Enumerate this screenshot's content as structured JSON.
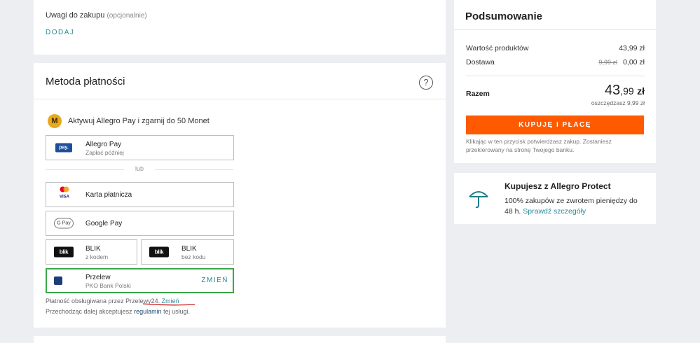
{
  "notes": {
    "label": "Uwagi do zakupu",
    "optional": "(opcjonalnie)",
    "add": "DODAJ"
  },
  "payment": {
    "title": "Metoda płatności",
    "help": "?",
    "promo": {
      "coin": "M",
      "text": "Aktywuj Allegro Pay i zgarnij do 50 Monet"
    },
    "allegro_pay": {
      "badge": "pay.",
      "name": "Allegro Pay",
      "sub": "Zapłać później"
    },
    "or": "lub",
    "card": {
      "name": "Karta płatnicza",
      "visa": "VISA"
    },
    "gpay": {
      "badge": "G Pay",
      "name": "Google Pay"
    },
    "blik1": {
      "badge": "blik",
      "name": "BLIK",
      "sub": "z kodem"
    },
    "blik2": {
      "badge": "blik",
      "name": "BLIK",
      "sub": "bez kodu"
    },
    "transfer": {
      "name": "Przelew",
      "sub": "PKO Bank Polski",
      "change": "ZMIEŃ"
    },
    "handled_by": "Płatność obsługiwana przez Przelewy24.",
    "handled_change": "Zmień",
    "accept_prefix": "Przechodząc dalej akceptujesz",
    "accept_link": "regulamin",
    "accept_suffix": "tej usługi."
  },
  "summary": {
    "title": "Podsumowanie",
    "products_label": "Wartość produktów",
    "products_value": "43,99 zł",
    "delivery_label": "Dostawa",
    "delivery_old": "9,99 zł",
    "delivery_value": "0,00 zł",
    "total_label": "Razem",
    "total_int": "43",
    "total_dec": ",99",
    "total_cur": "zł",
    "savings": "oszczędzasz 9,99 zł",
    "buy": "KUPUJĘ I PŁACĘ",
    "buy_note": "Klikając w ten przycisk potwierdzasz zakup. Zostaniesz przekierowany na stronę Twojego banku."
  },
  "protect": {
    "title": "Kupujesz z Allegro Protect",
    "text": "100% zakupów ze zwrotem pieniędzy do 48 h.",
    "link": "Sprawdź szczegóły"
  },
  "colors": {
    "accent": "#ff5a00",
    "link": "#2a8a9a",
    "selected_border": "#3aa84a"
  }
}
